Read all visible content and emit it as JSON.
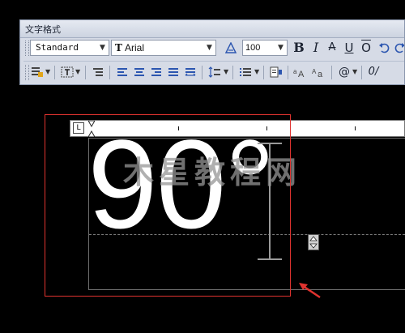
{
  "window": {
    "title": "文字格式"
  },
  "toolbar": {
    "style_value": "Standard",
    "font_value": "Arial",
    "font_type_glyph": "T",
    "size_value": "100",
    "bold_label": "B",
    "italic_label": "I",
    "strike_label": "A",
    "underline_label": "U",
    "overline_label": "O",
    "at_label": "@",
    "oblique_label": "0/"
  },
  "ruler": {
    "tab_button_label": "L"
  },
  "editor": {
    "text": "90°"
  },
  "watermark": {
    "text": "木星教程网"
  },
  "colors": {
    "annotation_red": "#e0332f",
    "background": "#000000",
    "toolbar_bg": "#d6dbe6"
  }
}
